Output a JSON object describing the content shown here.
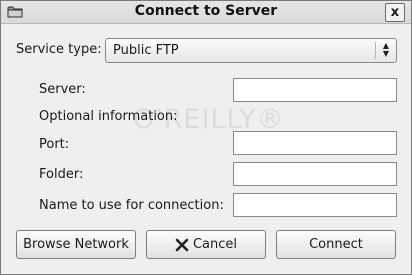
{
  "window": {
    "title": "Connect to Server",
    "close_label": "x",
    "folder_icon": "folder-icon"
  },
  "service_type": {
    "label": "Service type:",
    "value": "Public FTP",
    "arrows": "up-down-arrows-icon"
  },
  "fields": {
    "server_label": "Server:",
    "optional_label": "Optional information:",
    "port_label": "Port:",
    "folder_label": "Folder:",
    "name_label": "Name to use for connection:",
    "server_value": "",
    "port_value": "",
    "folder_value": "",
    "name_value": ""
  },
  "watermark": {
    "text": "O'REILLY®"
  },
  "buttons": {
    "browse": "Browse Network",
    "cancel": "Cancel",
    "connect": "Connect"
  },
  "colors": {
    "background": "#efefef",
    "border": "#7a7a7a"
  }
}
